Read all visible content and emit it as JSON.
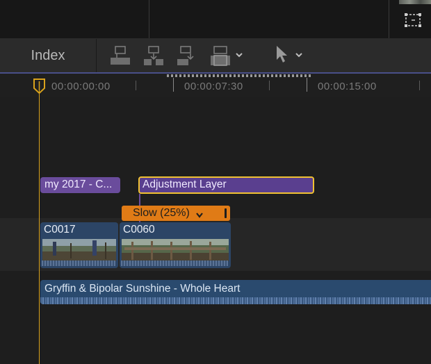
{
  "toolbar": {
    "index_label": "Index",
    "icons": [
      "connect-clip-icon",
      "insert-clip-icon",
      "append-clip-icon",
      "overwrite-clip-icon",
      "select-tool-icon"
    ]
  },
  "ruler": {
    "timecodes": [
      "00:00:00:00",
      "00:00:07:30",
      "00:00:15:00"
    ]
  },
  "timeline": {
    "connected_clips": [
      {
        "name": "my 2017 - C..."
      },
      {
        "name": "Adjustment Layer"
      }
    ],
    "retime": {
      "label": "Slow (25%)"
    },
    "primary_clips": [
      {
        "name": "C0017"
      },
      {
        "name": "C0060"
      }
    ],
    "audio_clip": {
      "name": "Gryffin & Bipolar Sunshine - Whole Heart"
    }
  },
  "colors": {
    "playhead": "#d9a21c",
    "title_clip": "#6a4c9c",
    "selection": "#f1c232",
    "retime_slow": "#e07b16",
    "video_clip": "#2c4566",
    "audio_clip": "#2a4a6e"
  }
}
